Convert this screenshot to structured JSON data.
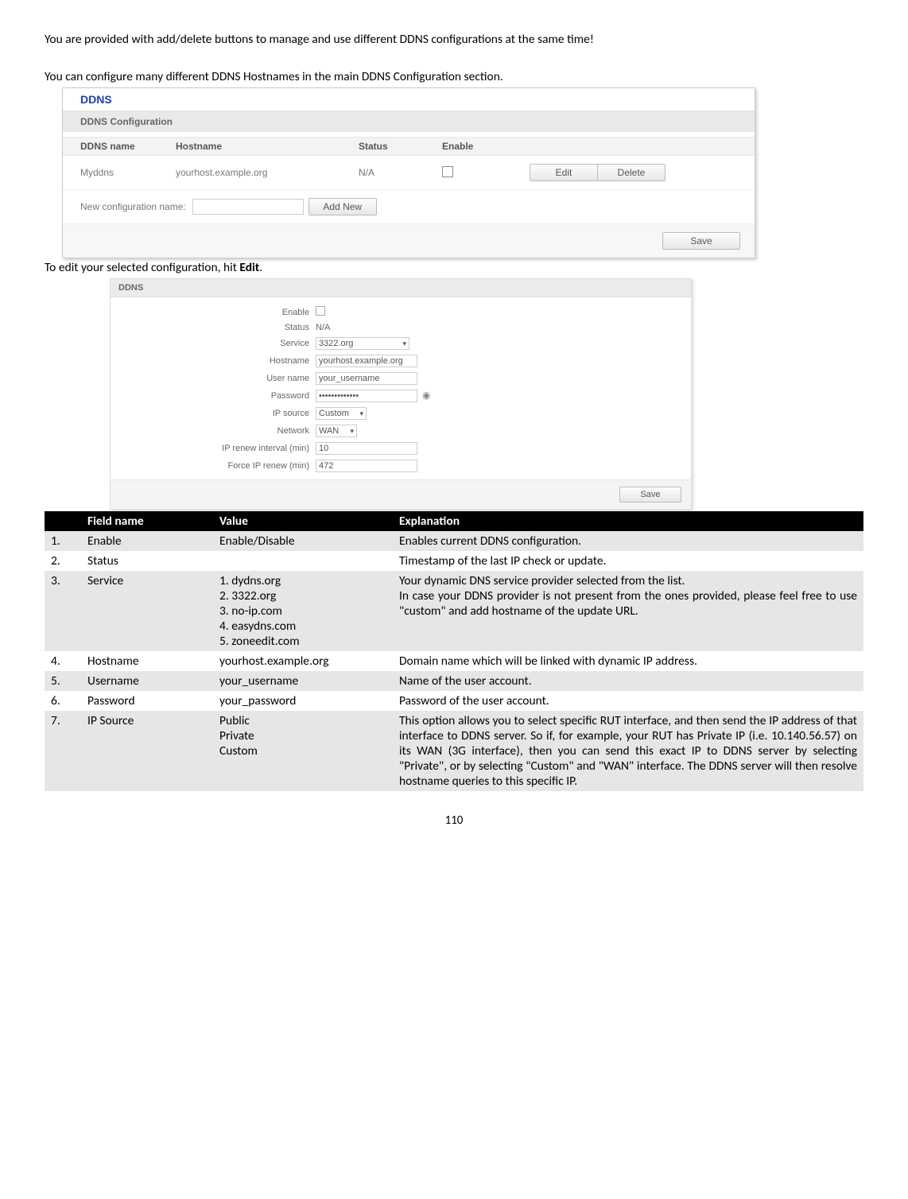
{
  "intro1": "You are provided with add/delete buttons to manage and use different DDNS configurations at the same time!",
  "intro2": "You can configure many different DDNS Hostnames in the main DDNS Configuration section.",
  "mid_text_pre": "To edit your selected configuration, hit ",
  "mid_text_bold": "Edit",
  "mid_text_post": ".",
  "shot1": {
    "title": "DDNS",
    "section": "DDNS Configuration",
    "headers": {
      "name": "DDNS name",
      "host": "Hostname",
      "status": "Status",
      "enable": "Enable"
    },
    "row": {
      "name": "Myddns",
      "host": "yourhost.example.org",
      "status": "N/A"
    },
    "buttons": {
      "edit": "Edit",
      "delete": "Delete",
      "addnew": "Add New",
      "save": "Save"
    },
    "newconf_label": "New configuration name:"
  },
  "shot2": {
    "title": "DDNS",
    "labels": {
      "enable": "Enable",
      "status": "Status",
      "service": "Service",
      "hostname": "Hostname",
      "username": "User name",
      "password": "Password",
      "ipsource": "IP source",
      "network": "Network",
      "iprenew": "IP renew interval (min)",
      "forceip": "Force IP renew (min)"
    },
    "values": {
      "status": "N/A",
      "service": "3322.org",
      "hostname": "yourhost.example.org",
      "username": "your_username",
      "password": "•••••••••••••",
      "ipsource": "Custom",
      "network": "WAN",
      "iprenew": "10",
      "forceip": "472"
    },
    "save": "Save"
  },
  "table": {
    "headers": {
      "num": "",
      "field": "Field name",
      "value": "Value",
      "expl": "Explanation"
    },
    "rows": [
      {
        "num": "1.",
        "field": "Enable",
        "value": "Enable/Disable",
        "expl": "Enables current DDNS configuration."
      },
      {
        "num": "2.",
        "field": "Status",
        "value": "",
        "expl": "Timestamp of the last IP check or update."
      },
      {
        "num": "3.",
        "field": "Service",
        "value": "1. dydns.org\n2. 3322.org\n3. no-ip.com\n4. easydns.com\n5. zoneedit.com",
        "expl": "Your dynamic DNS service provider selected from the list.\nIn case your DDNS provider is not present from the ones provided, please feel free to use \"custom\" and add hostname of the update URL."
      },
      {
        "num": "4.",
        "field": "Hostname",
        "value": "yourhost.example.org",
        "expl": "Domain name which will be linked with dynamic IP address."
      },
      {
        "num": "5.",
        "field": "Username",
        "value": "your_username",
        "expl": "Name of the user account."
      },
      {
        "num": "6.",
        "field": "Password",
        "value": "your_password",
        "expl": "Password of the user account."
      },
      {
        "num": "7.",
        "field": "IP Source",
        "value": "Public\nPrivate\nCustom",
        "expl": "This option allows you to select specific RUT interface, and then send the IP address of that interface to DDNS server. So if, for example, your RUT has Private IP (i.e. 10.140.56.57) on its WAN (3G interface), then you can send this exact IP to DDNS server by selecting \"Private\", or by selecting \"Custom\" and \"WAN\" interface. The DDNS server will then resolve hostname queries to this specific IP."
      }
    ]
  },
  "page_number": "110"
}
